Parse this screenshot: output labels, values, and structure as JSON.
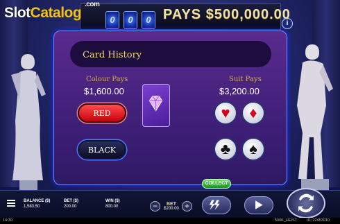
{
  "watermark": {
    "slot": "Slot",
    "catalog": "Catalog",
    "com": ".com"
  },
  "header": {
    "pays_text": "PAYS $500,000.00",
    "jackpot_symbol": "0",
    "info_label": "i"
  },
  "gamble": {
    "title": "Card History",
    "colour_pays_label": "Colour Pays",
    "colour_pays_value": "$1,600.00",
    "suit_pays_label": "Suit Pays",
    "suit_pays_value": "$3,200.00",
    "red_label": "RED",
    "black_label": "BLACK",
    "suits": [
      "♥",
      "♦",
      "♣",
      "♠"
    ],
    "collect_label": "COLLECT"
  },
  "footer": {
    "balance_label": "BALANCE ($)",
    "balance_value": "1,583.50",
    "bet_label": "BET ($)",
    "bet_value": "200.00",
    "win_label": "WIN ($)",
    "win_value": "800.00",
    "bet_stepper_label": "BET",
    "bet_stepper_value": "$200.00",
    "minus": "−",
    "plus": "+"
  },
  "status": {
    "time": "14:30",
    "game": "500K_HEIST",
    "id": "ID: 22453010"
  },
  "colors": {
    "accent_red": "#e3000f",
    "accent_blue": "#3a7fff",
    "gold": "#f0d26a",
    "collect_green": "#2fae2f"
  }
}
